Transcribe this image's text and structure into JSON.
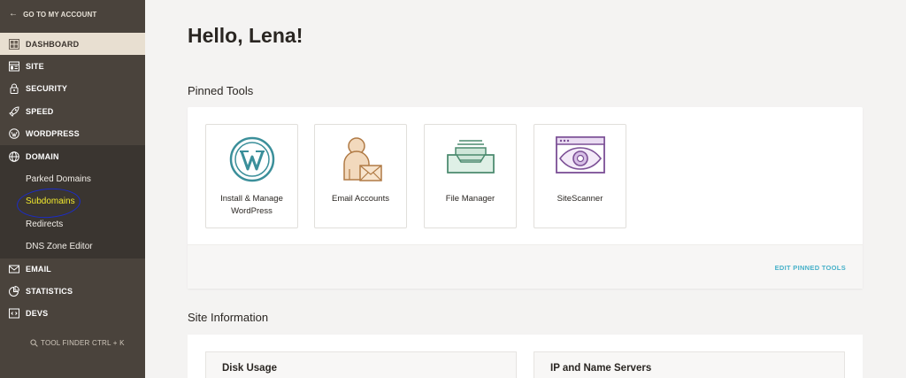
{
  "sidebar": {
    "back_label": "GO TO MY ACCOUNT",
    "nav": [
      {
        "label": "DASHBOARD",
        "icon": "dashboard-icon"
      },
      {
        "label": "SITE",
        "icon": "site-icon"
      },
      {
        "label": "SECURITY",
        "icon": "lock-icon"
      },
      {
        "label": "SPEED",
        "icon": "rocket-icon"
      },
      {
        "label": "WORDPRESS",
        "icon": "wordpress-icon"
      },
      {
        "label": "DOMAIN",
        "icon": "globe-icon"
      },
      {
        "label": "EMAIL",
        "icon": "envelope-icon"
      },
      {
        "label": "STATISTICS",
        "icon": "pie-chart-icon"
      },
      {
        "label": "DEVS",
        "icon": "code-icon"
      }
    ],
    "domain_sub": [
      "Parked Domains",
      "Subdomains",
      "Redirects",
      "DNS Zone Editor"
    ],
    "active": "DASHBOARD",
    "highlighted_sub": "Subdomains",
    "tool_finder": "TOOL FINDER CTRL + K"
  },
  "main": {
    "greeting": "Hello, Lena!",
    "pinned_title": "Pinned Tools",
    "tools": [
      {
        "label": "Install & Manage WordPress",
        "icon": "wordpress-logo-icon"
      },
      {
        "label": "Email Accounts",
        "icon": "user-envelope-icon"
      },
      {
        "label": "File Manager",
        "icon": "file-tray-icon"
      },
      {
        "label": "SiteScanner",
        "icon": "browser-eye-icon"
      }
    ],
    "edit_pinned": "EDIT PINNED TOOLS",
    "site_info_title": "Site Information",
    "info_boxes": [
      "Disk Usage",
      "IP and Name Servers"
    ]
  },
  "colors": {
    "sidebar_bg": "#4a433c",
    "active_bg": "#e8dfd1",
    "accent_link": "#47b1c9",
    "highlight_text": "#f2ea2e"
  }
}
